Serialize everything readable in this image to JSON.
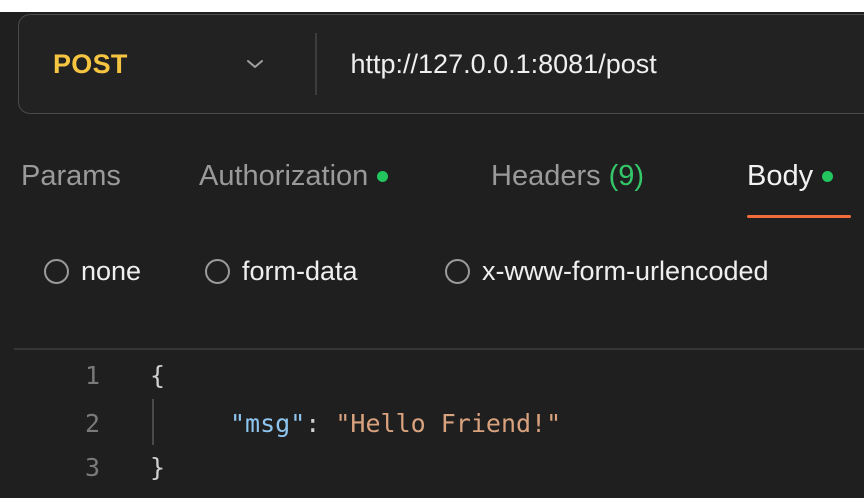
{
  "request": {
    "method": "POST",
    "url": "http://127.0.0.1:8081/post"
  },
  "tabs": {
    "params": "Params",
    "authorization": "Authorization",
    "headers": "Headers",
    "headers_count": "(9)",
    "body": "Body"
  },
  "body_types": {
    "none": "none",
    "form_data": "form-data",
    "urlencoded": "x-www-form-urlencoded"
  },
  "editor": {
    "line_numbers": [
      "1",
      "2",
      "3"
    ],
    "open_brace": "{",
    "key": "\"msg\"",
    "colon": ": ",
    "value": "\"Hello Friend!\"",
    "close_brace": "}"
  },
  "colors": {
    "method": "#f5c542",
    "active_dot": "#22c55e",
    "tab_underline": "#f26b3a",
    "json_key": "#8ec6f0",
    "json_string": "#d9a27e"
  }
}
